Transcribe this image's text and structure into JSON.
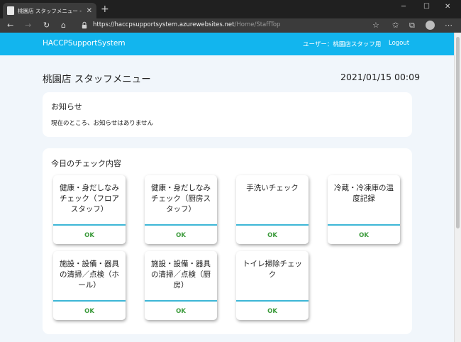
{
  "browser": {
    "tab_title": "桃園店 スタッフメニュー - HACCPSu",
    "url_host": "https://haccpsupportsystem.azurewebsites.net",
    "url_path": "/Home/StaffTop"
  },
  "header": {
    "brand": "HACCPSupportSystem",
    "user_label": "ユーザー：桃園店スタッフ用",
    "logout": "Logout"
  },
  "page": {
    "title": "桃園店 スタッフメニュー",
    "datetime": "2021/01/15 00:09"
  },
  "notice": {
    "title": "お知らせ",
    "body": "現在のところ、お知らせはありません"
  },
  "checks": {
    "title": "今日のチェック内容",
    "items": [
      {
        "label": "健康・身だしなみチェック（フロアスタッフ）",
        "status": "OK"
      },
      {
        "label": "健康・身だしなみチェック（厨房スタッフ）",
        "status": "OK"
      },
      {
        "label": "手洗いチェック",
        "status": "OK"
      },
      {
        "label": "冷蔵・冷凍庫の温度記録",
        "status": "OK"
      },
      {
        "label": "施設・設備・器具の清掃／点検（ホール）",
        "status": "OK"
      },
      {
        "label": "施設・設備・器具の清掃／点検（厨房）",
        "status": "OK"
      },
      {
        "label": "トイレ掃除チェック",
        "status": "OK"
      }
    ]
  },
  "colors": {
    "header_bg": "#12b5ee",
    "page_bg": "#f1f6fb",
    "ok_text": "#3a9a3a",
    "tile_divider": "#3db6d6"
  },
  "icons": {
    "tab": "page-icon",
    "nav": [
      "back-arrow-icon",
      "forward-arrow-icon",
      "refresh-icon",
      "home-icon"
    ],
    "address": "lock-icon",
    "toolbar": [
      "star-icon",
      "favorites-icon",
      "collections-icon",
      "profile-icon",
      "more-icon"
    ]
  }
}
